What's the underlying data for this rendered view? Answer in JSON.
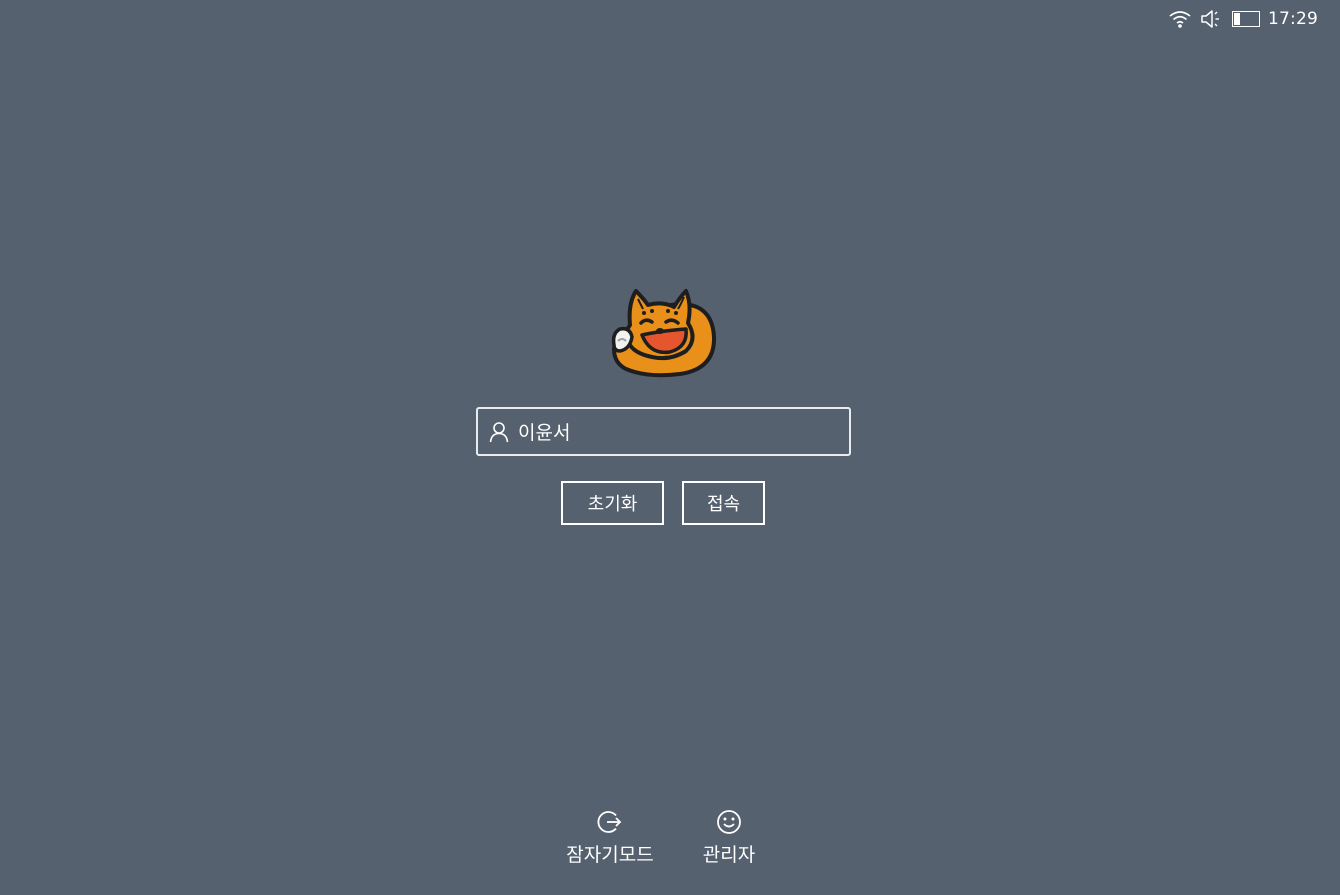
{
  "status_bar": {
    "icons": [
      "wifi-icon",
      "speaker-icon",
      "battery-icon"
    ],
    "battery_level": 0.25,
    "time": "17:29"
  },
  "login": {
    "mascot_icon": "fox-mascot",
    "user_icon": "user-icon",
    "username": "이윤서",
    "reset_label": "초기화",
    "login_label": "접속"
  },
  "bottom_actions": {
    "lock_icon": "exit-icon",
    "lock_label": "잠자기모드",
    "admin_icon": "smiley-icon",
    "admin_label": "관리자"
  },
  "colors": {
    "background": "#56616f",
    "foreground": "#ffffff",
    "mascot_orange": "#e8901a",
    "mascot_mouth": "#e5562f"
  }
}
